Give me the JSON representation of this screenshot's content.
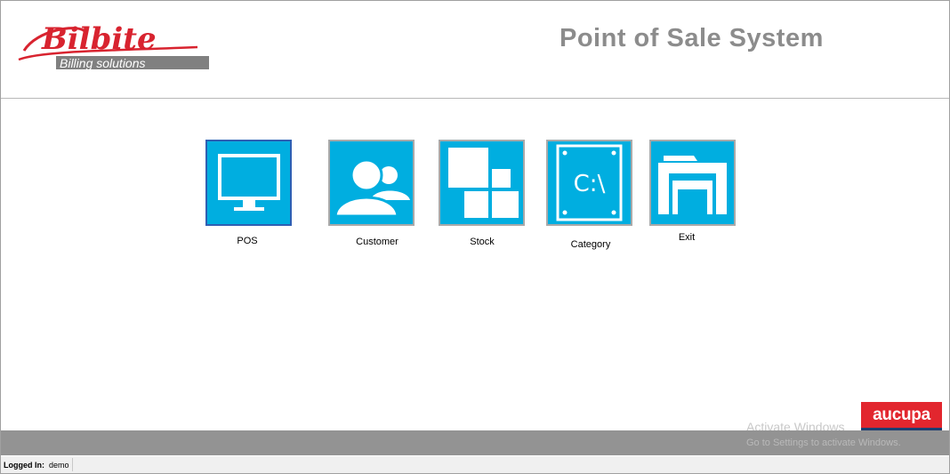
{
  "header": {
    "logo": {
      "brand_name": "Bilbite",
      "tagline": "Billing solutions",
      "brand_color": "#d8232f",
      "tagline_bg": "#808080"
    },
    "title": "Point of Sale System"
  },
  "tiles": [
    {
      "label": "POS",
      "icon": "monitor-icon",
      "selected": true
    },
    {
      "label": "Customer",
      "icon": "users-icon",
      "selected": false
    },
    {
      "label": "Stock",
      "icon": "blocks-icon",
      "selected": false
    },
    {
      "label": "Category",
      "icon": "drive-icon",
      "selected": false,
      "icon_text": "C:\\"
    },
    {
      "label": "Exit",
      "icon": "window-exit-icon",
      "selected": false
    }
  ],
  "watermark": {
    "title": "Activate Windows",
    "subtitle": "Go to Settings to activate Windows."
  },
  "brand_badge": {
    "text": "aucupa",
    "color": "#e2262e",
    "underline_color": "#1e3e70"
  },
  "status": {
    "label": "Logged In:",
    "user": "demo"
  },
  "colors": {
    "tile_bg": "#00aee0",
    "tile_border": "#a9a9a9",
    "tile_selected_border": "#2f5fb3",
    "footer_bg": "#939393"
  }
}
